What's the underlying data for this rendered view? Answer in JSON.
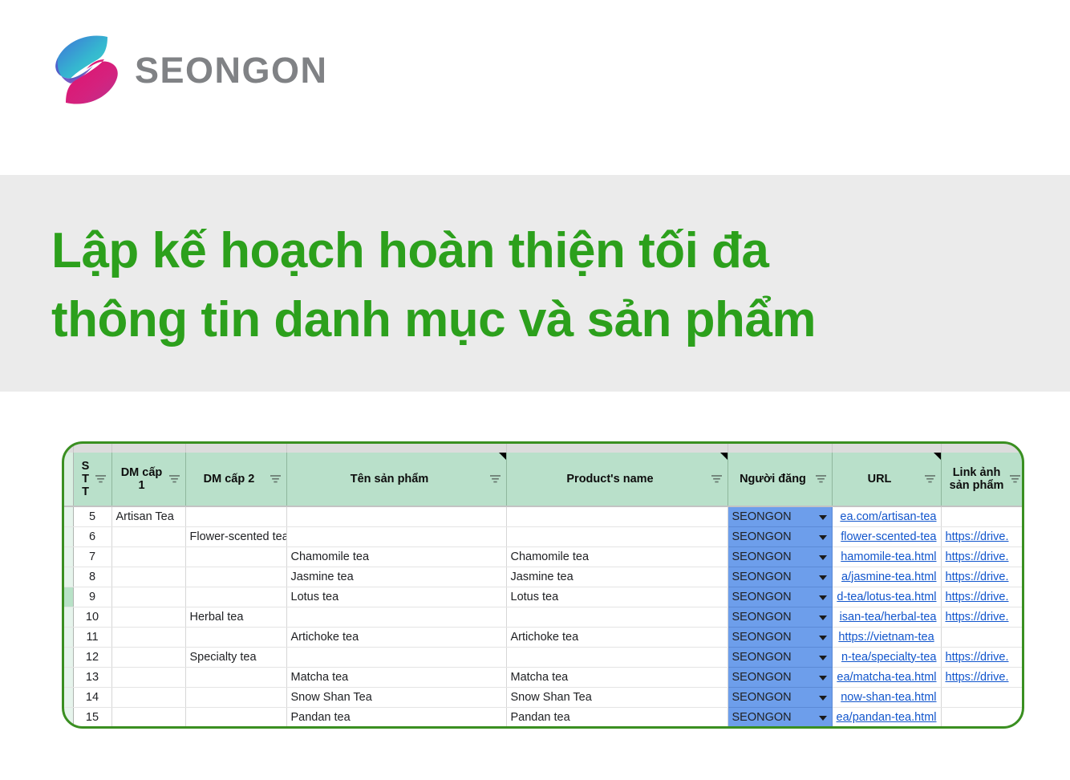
{
  "brand": {
    "name": "SEONGON",
    "logo_icon": "seongon-s-logo",
    "text_color": "#808285",
    "gradient_top": "#3fd9c9",
    "gradient_mid": "#3d79d4",
    "gradient_bottom": "#e3106c"
  },
  "title": {
    "line1": "Lập kế hoạch hoàn thiện tối đa",
    "line2": "thông tin danh mục và sản phẩm",
    "color": "#2ca01c",
    "band_background": "#ebebeb"
  },
  "spreadsheet": {
    "outline_color": "#3a8f21",
    "header_background": "#b9e0ca",
    "dropdown_cell_color": "#6d9eeb",
    "link_color": "#1155cc",
    "selected_row_gutter": "4",
    "filter_icon": "filter-icon",
    "note_icon": "note-triangle-icon",
    "dropdown_icon": "chevron-down-icon",
    "columns": [
      {
        "key": "stt",
        "label": "S\nT\nT",
        "filter": true,
        "note": false
      },
      {
        "key": "dm1",
        "label": "DM cấp 1",
        "filter": true,
        "note": false
      },
      {
        "key": "dm2",
        "label": "DM cấp 2",
        "filter": true,
        "note": false
      },
      {
        "key": "ten",
        "label": "Tên sản phẩm",
        "filter": true,
        "note": true
      },
      {
        "key": "pname",
        "label": "Product's name",
        "filter": true,
        "note": true
      },
      {
        "key": "nguoi",
        "label": "Người đăng",
        "filter": true,
        "note": false
      },
      {
        "key": "url",
        "label": "URL",
        "filter": true,
        "note": true
      },
      {
        "key": "link",
        "label": "Link ảnh sản phẩm",
        "filter": true,
        "note": false
      }
    ],
    "rows": [
      {
        "gutter": "0",
        "stt": "5",
        "dm1": "Artisan Tea",
        "dm2": "",
        "ten": "",
        "pname": "",
        "nguoi": "SEONGON",
        "url": "ea.com/artisan-tea",
        "url_center": false,
        "link": "",
        "selected": false
      },
      {
        "gutter": "1",
        "stt": "6",
        "dm1": "",
        "dm2": "Flower-scented tea",
        "ten": "",
        "pname": "",
        "nguoi": "SEONGON",
        "url": "flower-scented-tea",
        "url_center": false,
        "link": "https://drive.",
        "selected": false
      },
      {
        "gutter": "2",
        "stt": "7",
        "dm1": "",
        "dm2": "",
        "ten": "Chamomile tea",
        "pname": "Chamomile tea",
        "nguoi": "SEONGON",
        "url": "hamomile-tea.html",
        "url_center": false,
        "link": "https://drive.",
        "selected": false
      },
      {
        "gutter": "3",
        "stt": "8",
        "dm1": "",
        "dm2": "",
        "ten": "Jasmine tea",
        "pname": "Jasmine tea",
        "nguoi": "SEONGON",
        "url": "a/jasmine-tea.html",
        "url_center": false,
        "link": "https://drive.",
        "selected": false
      },
      {
        "gutter": "4",
        "stt": "9",
        "dm1": "",
        "dm2": "",
        "ten": "Lotus tea",
        "pname": "Lotus tea",
        "nguoi": "SEONGON",
        "url": "d-tea/lotus-tea.html",
        "url_center": false,
        "link": "https://drive.",
        "selected": true
      },
      {
        "gutter": "5",
        "stt": "10",
        "dm1": "",
        "dm2": "Herbal tea",
        "ten": "",
        "pname": "",
        "nguoi": "SEONGON",
        "url": "isan-tea/herbal-tea",
        "url_center": false,
        "link": "https://drive.",
        "selected": false
      },
      {
        "gutter": "6",
        "stt": "11",
        "dm1": "",
        "dm2": "",
        "ten": "Artichoke tea",
        "pname": "Artichoke tea",
        "nguoi": "SEONGON",
        "url": "https://vietnam-tea",
        "url_center": true,
        "link": "",
        "selected": false
      },
      {
        "gutter": "7",
        "stt": "12",
        "dm1": "",
        "dm2": "Specialty tea",
        "ten": "",
        "pname": "",
        "nguoi": "SEONGON",
        "url": "n-tea/specialty-tea",
        "url_center": false,
        "link": "https://drive.",
        "selected": false
      },
      {
        "gutter": "8",
        "stt": "13",
        "dm1": "",
        "dm2": "",
        "ten": "Matcha tea",
        "pname": "Matcha tea",
        "nguoi": "SEONGON",
        "url": "ea/matcha-tea.html",
        "url_center": false,
        "link": "https://drive.",
        "selected": false
      },
      {
        "gutter": "9",
        "stt": "14",
        "dm1": "",
        "dm2": "",
        "ten": "Snow Shan Tea",
        "pname": "Snow Shan Tea",
        "nguoi": "SEONGON",
        "url": "now-shan-tea.html",
        "url_center": false,
        "link": "",
        "selected": false
      },
      {
        "gutter": "",
        "stt": "15",
        "dm1": "",
        "dm2": "",
        "ten": "Pandan tea",
        "pname": "Pandan tea",
        "nguoi": "SEONGON",
        "url": "ea/pandan-tea.html",
        "url_center": false,
        "link": "",
        "selected": false
      }
    ]
  }
}
